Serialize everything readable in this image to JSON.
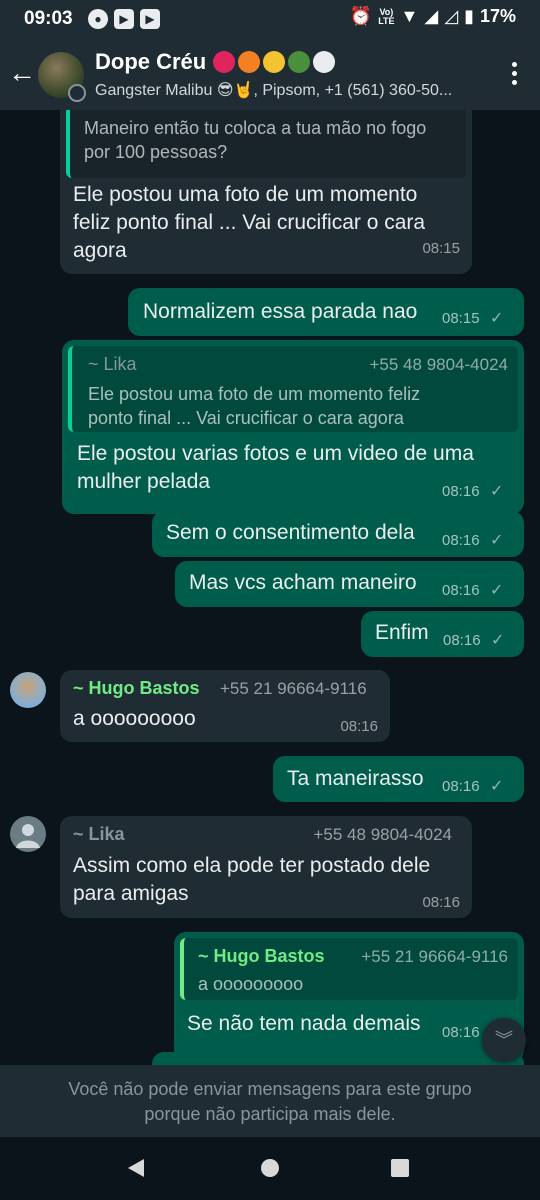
{
  "status_bar": {
    "time": "09:03",
    "battery": "17%",
    "network_label_top": "Vo)",
    "network_label_bottom": "LTE"
  },
  "header": {
    "group_name": "Dope Créu",
    "subtitle": "Gangster Malibu 😎🤘, Pipsom, +1 (561) 360-50..."
  },
  "messages": [
    {
      "id": "m1",
      "direction": "in",
      "quote_text": "Maneiro então tu coloca a tua mão no fogo por 100 pessoas?",
      "text_line1": "Ele postou uma foto de um momento",
      "text_line2": "feliz ponto final ... Vai crucificar o cara",
      "text_line3": "agora",
      "time": "08:15"
    },
    {
      "id": "m2",
      "direction": "out",
      "text": "Normalizem essa parada nao",
      "time": "08:15"
    },
    {
      "id": "m3",
      "direction": "out",
      "quote_name": "~ Lika",
      "quote_phone": "+55 48 9804-4024",
      "quote_line1": "Ele postou uma foto de um momento feliz",
      "quote_line2": "ponto final ... Vai crucificar o cara agora",
      "text_line1": "Ele postou varias fotos e um video de uma",
      "text_line2": "mulher pelada",
      "time": "08:16"
    },
    {
      "id": "m4",
      "direction": "out",
      "text": "Sem o consentimento dela",
      "time": "08:16"
    },
    {
      "id": "m5",
      "direction": "out",
      "text": "Mas vcs acham maneiro",
      "time": "08:16"
    },
    {
      "id": "m6",
      "direction": "out",
      "text": "Enfim",
      "time": "08:16"
    },
    {
      "id": "m7",
      "direction": "in",
      "sender": "~ Hugo Bastos",
      "sender_phone": "+55 21 96664-9116",
      "text": "a ooooooooo",
      "time": "08:16"
    },
    {
      "id": "m8",
      "direction": "out",
      "text": "Ta maneirasso",
      "time": "08:16"
    },
    {
      "id": "m9",
      "direction": "in",
      "sender": "~ Lika",
      "sender_phone": "+55 48 9804-4024",
      "text_line1": "Assim como ela pode ter postado dele",
      "text_line2": "para amigas",
      "time": "08:16"
    },
    {
      "id": "m10",
      "direction": "out",
      "quote_name": "~ Hugo Bastos",
      "quote_phone": "+55 21 96664-9116",
      "quote_text": "a ooooooooo",
      "text": "Se não tem nada demais",
      "time": "08:16"
    }
  ],
  "footer": {
    "line1": "Você não pode enviar mensagens para este grupo",
    "line2": "porque não participa mais dele."
  },
  "colors": {
    "background": "#0b141a",
    "bar": "#1f2c34",
    "incoming": "#1f2c34",
    "outgoing": "#005c4b",
    "sender_green": "#53bdeb",
    "hugo_green": "#71eb85",
    "accent": "#06cf9c"
  }
}
